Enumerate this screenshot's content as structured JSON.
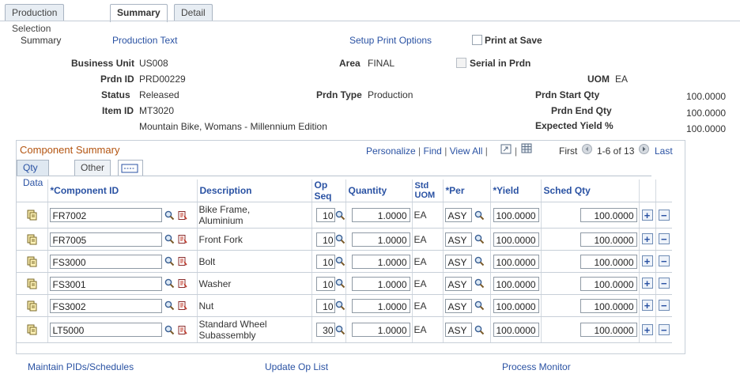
{
  "tabs": [
    {
      "label": "Production Selection"
    },
    {
      "label": "Summary"
    },
    {
      "label": "Detail"
    }
  ],
  "summary": {
    "section_label": "Summary",
    "production_text_link": "Production Text",
    "setup_print_link": "Setup Print Options",
    "print_at_save_label": "Print at Save",
    "serial_in_prdn_label": "Serial in Prdn",
    "business_unit_label": "Business Unit",
    "business_unit": "US008",
    "area_label": "Area",
    "area": "FINAL",
    "prdn_id_label": "Prdn ID",
    "prdn_id": "PRD00229",
    "uom_label": "UOM",
    "uom": "EA",
    "status_label": "Status",
    "status": "Released",
    "prdn_type_label": "Prdn Type",
    "prdn_type": "Production",
    "start_qty_label": "Prdn Start Qty",
    "start_qty": "100.0000",
    "item_id_label": "Item ID",
    "item_id": "MT3020",
    "end_qty_label": "Prdn End Qty",
    "end_qty": "100.0000",
    "item_desc": "Mountain Bike, Womans - Millennium Edition",
    "yield_label": "Expected Yield %",
    "yield": "100.0000"
  },
  "grid": {
    "title": "Component Summary",
    "personalize": "Personalize",
    "find": "Find",
    "view_all": "View All",
    "first": "First",
    "range": "1-6 of 13",
    "last": "Last",
    "subtabs": [
      {
        "label": "Qty Data"
      },
      {
        "label": "Other"
      }
    ],
    "headers": {
      "component_id": "*Component ID",
      "description": "Description",
      "op_seq": "Op Seq",
      "quantity": "Quantity",
      "std_uom_1": "Std",
      "std_uom_2": "UOM",
      "per": "*Per",
      "yield": "*Yield",
      "sched_qty": "Sched Qty"
    },
    "rows": [
      {
        "component_id": "FR7002",
        "desc1": "Bike Frame,",
        "desc2": "Aluminium",
        "op_seq": "10",
        "quantity": "1.0000",
        "uom": "EA",
        "per": "ASY",
        "yield": "100.0000",
        "sched_qty": "100.0000"
      },
      {
        "component_id": "FR7005",
        "desc1": "Front Fork",
        "desc2": "",
        "op_seq": "10",
        "quantity": "1.0000",
        "uom": "EA",
        "per": "ASY",
        "yield": "100.0000",
        "sched_qty": "100.0000"
      },
      {
        "component_id": "FS3000",
        "desc1": "Bolt",
        "desc2": "",
        "op_seq": "10",
        "quantity": "1.0000",
        "uom": "EA",
        "per": "ASY",
        "yield": "100.0000",
        "sched_qty": "100.0000"
      },
      {
        "component_id": "FS3001",
        "desc1": "Washer",
        "desc2": "",
        "op_seq": "10",
        "quantity": "1.0000",
        "uom": "EA",
        "per": "ASY",
        "yield": "100.0000",
        "sched_qty": "100.0000"
      },
      {
        "component_id": "FS3002",
        "desc1": "Nut",
        "desc2": "",
        "op_seq": "10",
        "quantity": "1.0000",
        "uom": "EA",
        "per": "ASY",
        "yield": "100.0000",
        "sched_qty": "100.0000"
      },
      {
        "component_id": "LT5000",
        "desc1": "Standard Wheel",
        "desc2": "Subassembly",
        "op_seq": "30",
        "quantity": "1.0000",
        "uom": "EA",
        "per": "ASY",
        "yield": "100.0000",
        "sched_qty": "100.0000"
      }
    ]
  },
  "footer": {
    "maintain_pids": "Maintain PIDs/Schedules",
    "update_op_list": "Update Op List",
    "process_monitor": "Process Monitor"
  },
  "colors": {
    "link": "#2a52a3",
    "grid_title": "#b35410"
  }
}
